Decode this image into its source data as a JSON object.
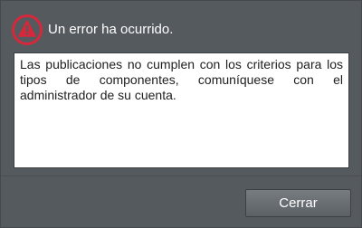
{
  "dialog": {
    "title": "Un error ha ocurrido.",
    "message": "Las publicaciones no cumplen con los criterios para los tipos de componentes, comuníquese con el administrador de su cuenta.",
    "close_label": "Cerrar",
    "icon": "error-warning-icon"
  },
  "colors": {
    "background": "#555a5f",
    "accent_red": "#d6283a",
    "title_text": "#ffffff",
    "message_text": "#1e1e1e"
  }
}
